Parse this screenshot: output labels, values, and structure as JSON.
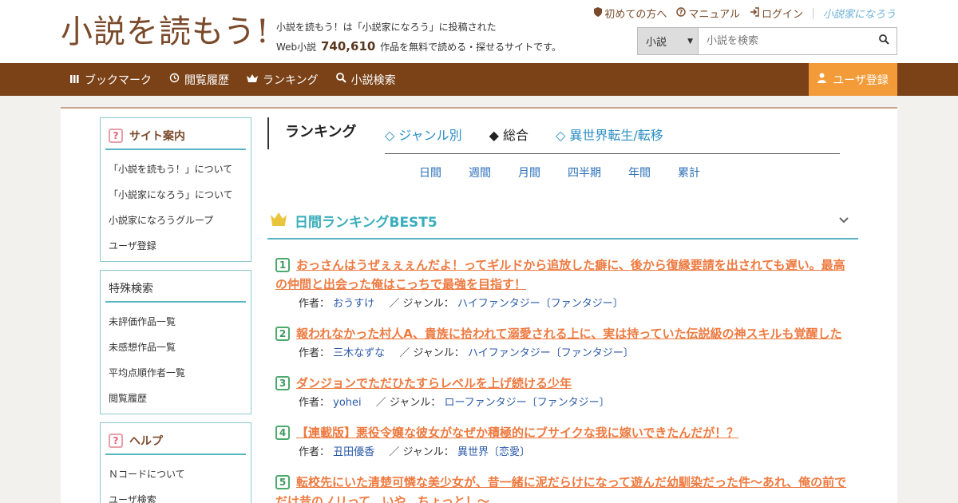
{
  "header": {
    "logo": "小説を読もう!",
    "tagline_line1": "小説を読もう！は「小説家になろう」に投稿された",
    "tagline_prefix": "Web小説",
    "tagline_count": "740,610",
    "tagline_suffix": "作品を無料で読める・探せるサイトです。",
    "top_links": [
      "初めての方へ",
      "マニュアル",
      "ログイン"
    ],
    "brand": "小説家になろう",
    "search_select": "小説",
    "search_placeholder": "小説を検索"
  },
  "nav": {
    "items": [
      "ブックマーク",
      "閲覧履歴",
      "ランキング",
      "小説検索"
    ],
    "register": "ユーザ登録"
  },
  "sidebar": {
    "site_guide": {
      "title": "サイト案内",
      "items": [
        "「小説を読もう！」について",
        "「小説家になろう」について",
        "小説家になろうグループ",
        "ユーザ登録"
      ]
    },
    "special_search": {
      "title": "特殊検索",
      "items": [
        "未評価作品一覧",
        "未感想作品一覧",
        "平均点順作者一覧",
        "閲覧履歴"
      ]
    },
    "help": {
      "title": "ヘルプ",
      "items": [
        "Ｎコードについて",
        "ユーザ検索"
      ]
    }
  },
  "ranking": {
    "title": "ランキング",
    "tabs": [
      "◇ ジャンル別",
      "◆ 総合",
      "◇ 異世界転生/転移"
    ],
    "periods": [
      "日間",
      "週間",
      "月間",
      "四半期",
      "年間",
      "累計"
    ],
    "best_label": "日間ランキングBEST5",
    "author_label": "作者：",
    "genre_label": "ジャンル：",
    "entries": [
      {
        "rank": "1",
        "title": "おっさんはうぜぇぇぇんだよ！ってギルドから追放した癖に、後から復縁要請を出されても遅い。最高の仲間と出会った俺はこっちで最強を目指す！",
        "author": "おうすけ",
        "genre": "ハイファンタジー〔ファンタジー〕"
      },
      {
        "rank": "2",
        "title": "報われなかった村人A、貴族に拾われて溺愛される上に、実は持っていた伝説級の神スキルも覚醒した",
        "author": "三木なずな",
        "genre": "ハイファンタジー〔ファンタジー〕"
      },
      {
        "rank": "3",
        "title": "ダンジョンでただひたすらレベルを上げ続ける少年",
        "author": "yohei",
        "genre": "ローファンタジー〔ファンタジー〕"
      },
      {
        "rank": "4",
        "title": "【連載版】悪役令嬢な彼女がなぜか積極的にブサイクな我に嫁いできたんだが！？",
        "author": "丑田優香",
        "genre": "異世界〔恋愛〕"
      },
      {
        "rank": "5",
        "title": "転校先にいた清楚可憐な美少女が、昔一緒に泥だらけになって遊んだ幼馴染だった件～あれ、俺の前でだけ昔のノリって、いや、ちょっと！～",
        "author": "",
        "genre": ""
      }
    ]
  }
}
